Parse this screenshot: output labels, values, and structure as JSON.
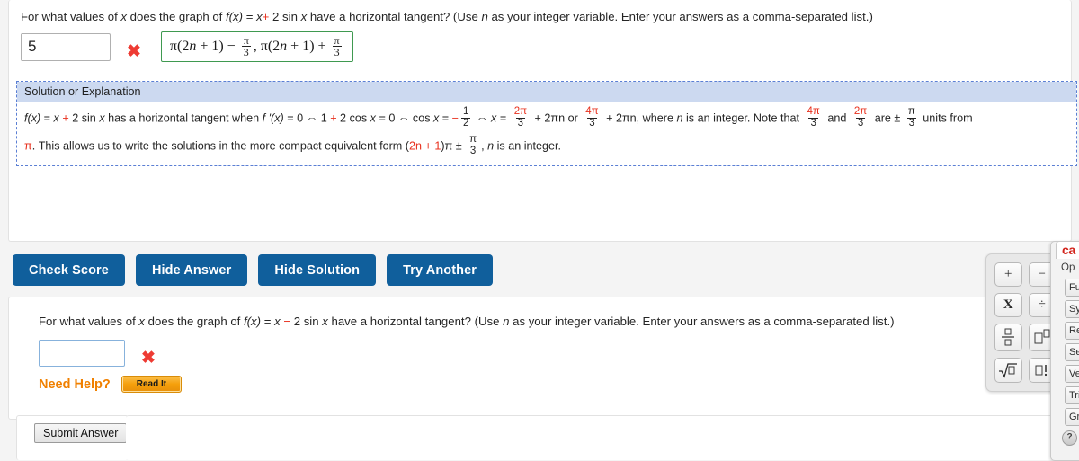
{
  "question1": {
    "prompt_before": "For what values of ",
    "var_x": "x",
    "prompt_mid": " does the graph of  ",
    "fx": "f(x)",
    "eq": " = ",
    "x2": "x",
    "plus": "+",
    "two_sin": "2 sin ",
    "x3": "x",
    "prompt_after": "  have a horizontal tangent? (Use ",
    "n_var": "n",
    "prompt_end": " as your integer variable. Enter your answers as a comma-separated list.)",
    "answer_value": "5",
    "answer_status": "incorrect",
    "status_icon": "x-mark-icon",
    "correct_answer_text": "π(2n + 1) − π/3, π(2n + 1) + π/3"
  },
  "solution": {
    "header": "Solution or Explanation",
    "line1_a": "f(x)",
    "line1_b": " = ",
    "line1_c": "x",
    "line1_plus": "+",
    "line1_d": " 2 sin ",
    "line1_e": "x",
    "line1_f": "  has a horizontal tangent when  ",
    "line1_g": "f '(x)",
    "line1_h": " = 0  ⇔  1 ",
    "line1_plus2": "+",
    "line1_i": " 2 cos ",
    "line1_j": "x",
    "line1_k": " = 0  ⇔  cos ",
    "line1_l": "x",
    "line1_m": " = ",
    "minus": "−",
    "half_num": "1",
    "half_den": "2",
    "line1_n": "  ⇔  ",
    "line1_o": "x",
    "line1_p": " = ",
    "frac_2pi_num": "2π",
    "frac_3_den": "3",
    "line1_q": " + 2πn or ",
    "frac_4pi_num": "4π",
    "line1_r": " + 2πn,  where ",
    "line1_s": "n",
    "line1_t": " is an integer. Note that ",
    "line1_u": " and ",
    "line1_v": " are ± ",
    "pi_num": "π",
    "line1_w": " units from",
    "line2_pi": "π",
    "line2_a": ". This allows us to write the solutions in the more compact equivalent form  (",
    "line2_2n1": "2n + 1",
    "line2_b": ")π ± ",
    "line2_c": ", ",
    "line2_n": "n",
    "line2_d": " is an integer."
  },
  "buttons": {
    "check_score": "Check Score",
    "hide_answer": "Hide Answer",
    "hide_solution": "Hide Solution",
    "try_another": "Try Another"
  },
  "question2": {
    "prompt_before": "For what values of ",
    "var_x": "x",
    "prompt_mid": " does the graph of  ",
    "fx": "f(x)",
    "eq": " = ",
    "x2": "x",
    "minus": "−",
    "two_sin": " 2 sin ",
    "x3": "x",
    "prompt_after": "  have a horizontal tangent? (Use ",
    "n_var": "n",
    "prompt_end": " as your integer variable. Enter your answers as a comma-separated list.)",
    "answer_value": "",
    "placeholder": "",
    "answer_status": "incorrect",
    "status_icon": "x-mark-icon",
    "need_help_label": "Need Help?",
    "read_it_label": "Read It"
  },
  "footer": {
    "submit_label": "Submit Answer"
  },
  "calculator": {
    "brand": "ca",
    "options_label": "Op",
    "keys": [
      {
        "name": "plus-key",
        "glyph": "+"
      },
      {
        "name": "minus-key",
        "glyph": "−"
      },
      {
        "name": "multiply-key",
        "glyph": "X"
      },
      {
        "name": "divide-key",
        "glyph": "÷"
      },
      {
        "name": "fraction-key",
        "glyph": "fraction"
      },
      {
        "name": "exponent-key",
        "glyph": "exponent"
      },
      {
        "name": "square-root-key",
        "glyph": "sqrt"
      },
      {
        "name": "factorial-key",
        "glyph": "factorial"
      }
    ],
    "menu": [
      {
        "name": "functions",
        "label": "Fu"
      },
      {
        "name": "symbols",
        "label": "Sy"
      },
      {
        "name": "relations",
        "label": "Re"
      },
      {
        "name": "sets",
        "label": "Se"
      },
      {
        "name": "vectors",
        "label": "Ve"
      },
      {
        "name": "trig",
        "label": "Tri"
      },
      {
        "name": "greek",
        "label": "Gr"
      }
    ],
    "help_glyph": "?"
  },
  "colors": {
    "button_blue": "#105f9c",
    "accent_red": "#e8301d",
    "correct_green": "#3f9950",
    "help_orange": "#f08000",
    "solution_border": "#5b7fd4",
    "solution_header_bg": "#ccd9f0"
  }
}
